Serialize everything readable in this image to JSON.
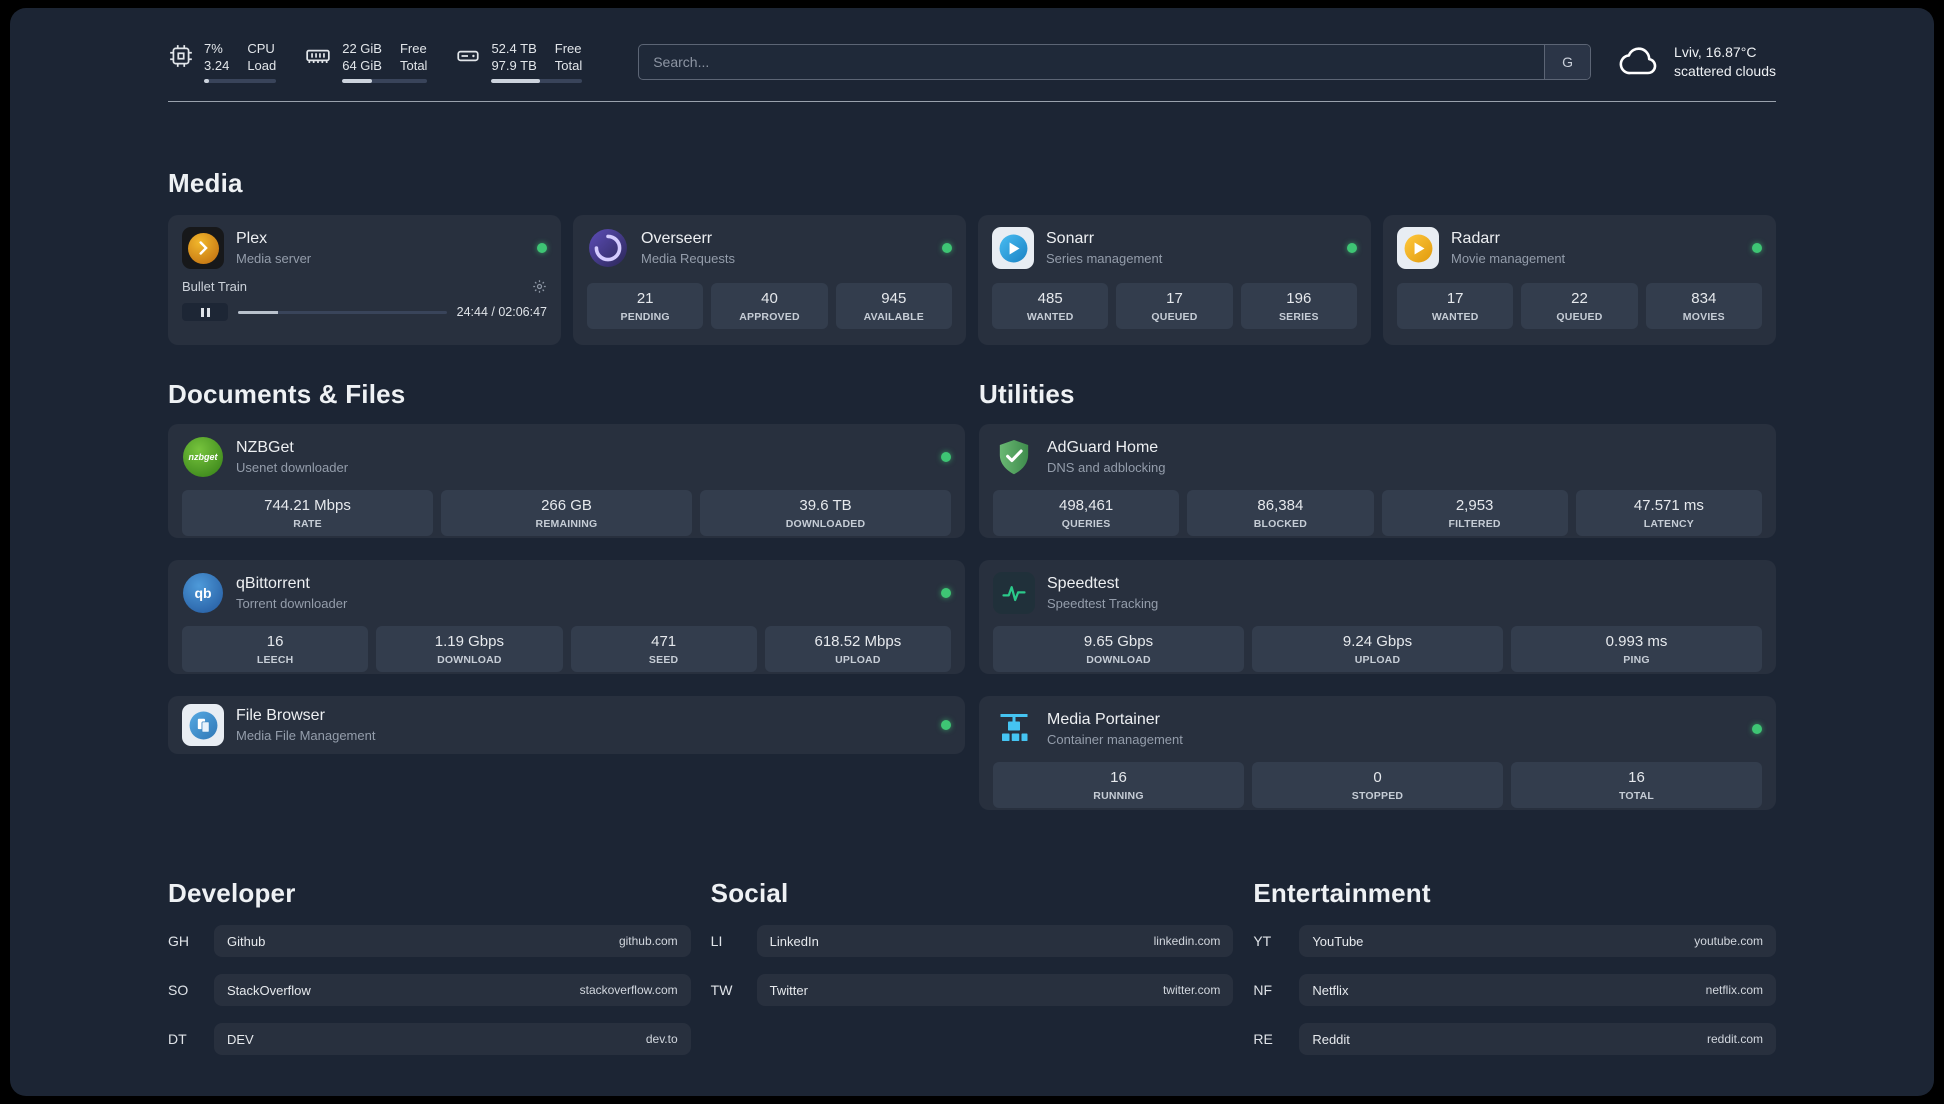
{
  "header": {
    "cpu": {
      "value_top": "7%",
      "value_bottom": "3.24",
      "label_top": "CPU",
      "label_bottom": "Load",
      "bar_percent": 7
    },
    "memory": {
      "value_top": "22 GiB",
      "value_bottom": "64 GiB",
      "label_top": "Free",
      "label_bottom": "Total",
      "bar_percent": 35
    },
    "disk": {
      "value_top": "52.4 TB",
      "value_bottom": "97.9 TB",
      "label_top": "Free",
      "label_bottom": "Total",
      "bar_percent": 53
    },
    "search": {
      "placeholder": "Search...",
      "button_label": "G"
    },
    "weather": {
      "location": "Lviv, 16.87°C",
      "condition": "scattered clouds"
    }
  },
  "media": {
    "title": "Media",
    "plex": {
      "name": "Plex",
      "subtitle": "Media server",
      "now_playing": "Bullet Train",
      "time": "24:44 / 02:06:47",
      "progress_percent": 19
    },
    "overseerr": {
      "name": "Overseerr",
      "subtitle": "Media Requests",
      "stats": [
        {
          "value": "21",
          "label": "PENDING"
        },
        {
          "value": "40",
          "label": "APPROVED"
        },
        {
          "value": "945",
          "label": "AVAILABLE"
        }
      ]
    },
    "sonarr": {
      "name": "Sonarr",
      "subtitle": "Series management",
      "stats": [
        {
          "value": "485",
          "label": "WANTED"
        },
        {
          "value": "17",
          "label": "QUEUED"
        },
        {
          "value": "196",
          "label": "SERIES"
        }
      ]
    },
    "radarr": {
      "name": "Radarr",
      "subtitle": "Movie management",
      "stats": [
        {
          "value": "17",
          "label": "WANTED"
        },
        {
          "value": "22",
          "label": "QUEUED"
        },
        {
          "value": "834",
          "label": "MOVIES"
        }
      ]
    }
  },
  "documents": {
    "title": "Documents & Files",
    "nzbget": {
      "name": "NZBGet",
      "subtitle": "Usenet downloader",
      "icon_text": "nzbget",
      "stats": [
        {
          "value": "744.21 Mbps",
          "label": "RATE"
        },
        {
          "value": "266 GB",
          "label": "REMAINING"
        },
        {
          "value": "39.6 TB",
          "label": "DOWNLOADED"
        }
      ]
    },
    "qbittorrent": {
      "name": "qBittorrent",
      "subtitle": "Torrent downloader",
      "icon_text": "qb",
      "stats": [
        {
          "value": "16",
          "label": "LEECH"
        },
        {
          "value": "1.19 Gbps",
          "label": "DOWNLOAD"
        },
        {
          "value": "471",
          "label": "SEED"
        },
        {
          "value": "618.52 Mbps",
          "label": "UPLOAD"
        }
      ]
    },
    "filebrowser": {
      "name": "File Browser",
      "subtitle": "Media File Management"
    }
  },
  "utilities": {
    "title": "Utilities",
    "adguard": {
      "name": "AdGuard Home",
      "subtitle": "DNS and adblocking",
      "stats": [
        {
          "value": "498,461",
          "label": "QUERIES"
        },
        {
          "value": "86,384",
          "label": "BLOCKED"
        },
        {
          "value": "2,953",
          "label": "FILTERED"
        },
        {
          "value": "47.571 ms",
          "label": "LATENCY"
        }
      ]
    },
    "speedtest": {
      "name": "Speedtest",
      "subtitle": "Speedtest Tracking",
      "stats": [
        {
          "value": "9.65 Gbps",
          "label": "DOWNLOAD"
        },
        {
          "value": "9.24 Gbps",
          "label": "UPLOAD"
        },
        {
          "value": "0.993 ms",
          "label": "PING"
        }
      ]
    },
    "portainer": {
      "name": "Media Portainer",
      "subtitle": "Container management",
      "stats": [
        {
          "value": "16",
          "label": "RUNNING"
        },
        {
          "value": "0",
          "label": "STOPPED"
        },
        {
          "value": "16",
          "label": "TOTAL"
        }
      ]
    }
  },
  "bookmark_groups": [
    {
      "title": "Developer",
      "items": [
        {
          "abbr": "GH",
          "name": "Github",
          "url": "github.com"
        },
        {
          "abbr": "SO",
          "name": "StackOverflow",
          "url": "stackoverflow.com"
        },
        {
          "abbr": "DT",
          "name": "DEV",
          "url": "dev.to"
        }
      ]
    },
    {
      "title": "Social",
      "items": [
        {
          "abbr": "LI",
          "name": "LinkedIn",
          "url": "linkedin.com"
        },
        {
          "abbr": "TW",
          "name": "Twitter",
          "url": "twitter.com"
        }
      ]
    },
    {
      "title": "Entertainment",
      "items": [
        {
          "abbr": "YT",
          "name": "YouTube",
          "url": "youtube.com"
        },
        {
          "abbr": "NF",
          "name": "Netflix",
          "url": "netflix.com"
        },
        {
          "abbr": "RE",
          "name": "Reddit",
          "url": "reddit.com"
        }
      ]
    }
  ]
}
